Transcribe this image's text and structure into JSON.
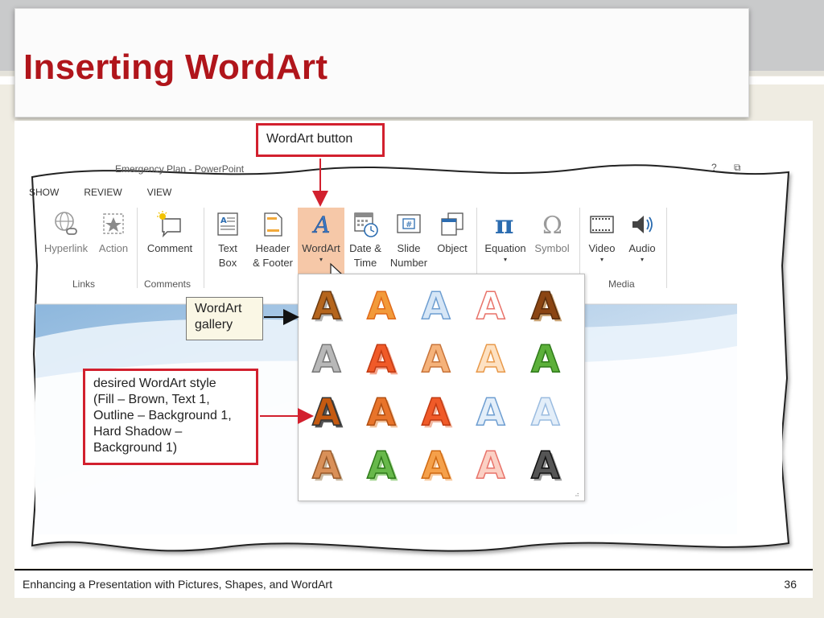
{
  "slide": {
    "title": "Inserting WordArt",
    "footer_text": "Enhancing a Presentation with Pictures, Shapes, and WordArt",
    "page_number": "36"
  },
  "window": {
    "title": "Emergency Plan - PowerPoint",
    "help_icon": "question-mark",
    "restore_icon": "ribbon-display-options"
  },
  "tabs": [
    "SHOW",
    "REVIEW",
    "VIEW"
  ],
  "ribbon": {
    "links": {
      "group_label": "Links",
      "hyperlink": "Hyperlink",
      "action": "Action"
    },
    "comments": {
      "group_label": "Comments",
      "comment": "Comment"
    },
    "text": {
      "text_box_1": "Text",
      "text_box_2": "Box",
      "header_1": "Header",
      "header_2": "& Footer",
      "wordart_1": "WordArt",
      "wordart_caret": "▾",
      "datetime_1": "Date &",
      "datetime_2": "Time",
      "slide_1": "Slide",
      "slide_2": "Number",
      "object": "Object"
    },
    "symbols": {
      "equation": "Equation",
      "equation_caret": "▾",
      "symbol": "Symbol"
    },
    "media": {
      "group_label": "Media",
      "video": "Video",
      "video_caret": "▾",
      "audio": "Audio",
      "audio_caret": "▾"
    }
  },
  "callouts": {
    "wordart_button": "WordArt button",
    "gallery_line1": "WordArt",
    "gallery_line2": "gallery",
    "style_line1": "desired WordArt style",
    "style_line2": "(Fill – Brown, Text 1,",
    "style_line3": "Outline – Background 1,",
    "style_line4": "Hard Shadow –",
    "style_line5": "Background 1)"
  },
  "gallery": {
    "glyph": "A",
    "grip": "⠴",
    "styles": [
      {
        "fill": "#b5651d",
        "stroke": "#6b3a10",
        "shadow": "#b3b3b3"
      },
      {
        "fill": "#f29a3a",
        "stroke": "#e06a1a",
        "shadow": "none"
      },
      {
        "fill": "#d6e6f6",
        "stroke": "#6e9ed1",
        "shadow": "none"
      },
      {
        "fill": "#ffffff",
        "stroke": "#e8736a",
        "shadow": "none"
      },
      {
        "fill": "#8b4513",
        "stroke": "#5a2d0c",
        "shadow": "#c8a273"
      },
      {
        "fill": "#b8b8b8",
        "stroke": "#777777",
        "shadow": "none"
      },
      {
        "fill": "#f05a28",
        "stroke": "#c13a12",
        "shadow": "#f2a28a"
      },
      {
        "fill": "#f5b27a",
        "stroke": "#c8743a",
        "shadow": "none"
      },
      {
        "fill": "#fde1c2",
        "stroke": "#e8994a",
        "shadow": "none"
      },
      {
        "fill": "#5cb03a",
        "stroke": "#2f7a1a",
        "shadow": "none"
      },
      {
        "fill": "#c55a11",
        "stroke": "#333333",
        "shadow": "#555555"
      },
      {
        "fill": "#e8742a",
        "stroke": "#b14f12",
        "shadow": "#f1c19a"
      },
      {
        "fill": "#f05a28",
        "stroke": "#c13a12",
        "shadow": "#f1b7a0"
      },
      {
        "fill": "#e3eef9",
        "stroke": "#6e9ed1",
        "shadow": "none"
      },
      {
        "fill": "#e3eef9",
        "stroke": "#9bbce0",
        "shadow": "none"
      },
      {
        "fill": "#d99058",
        "stroke": "#9a5a2a",
        "shadow": "#c9b8a0"
      },
      {
        "fill": "#67b84a",
        "stroke": "#2f7a1a",
        "shadow": "#9dd38a"
      },
      {
        "fill": "#f5a04a",
        "stroke": "#d06a12",
        "shadow": "#f8c89a"
      },
      {
        "fill": "#fbd0c4",
        "stroke": "#e8736a",
        "shadow": "none"
      },
      {
        "fill": "#555555",
        "stroke": "#111111",
        "shadow": "#999999"
      }
    ]
  },
  "colors": {
    "title_red": "#b0151b",
    "callout_red": "#d2202e",
    "wordart_highlight": "#f6c8a8"
  }
}
